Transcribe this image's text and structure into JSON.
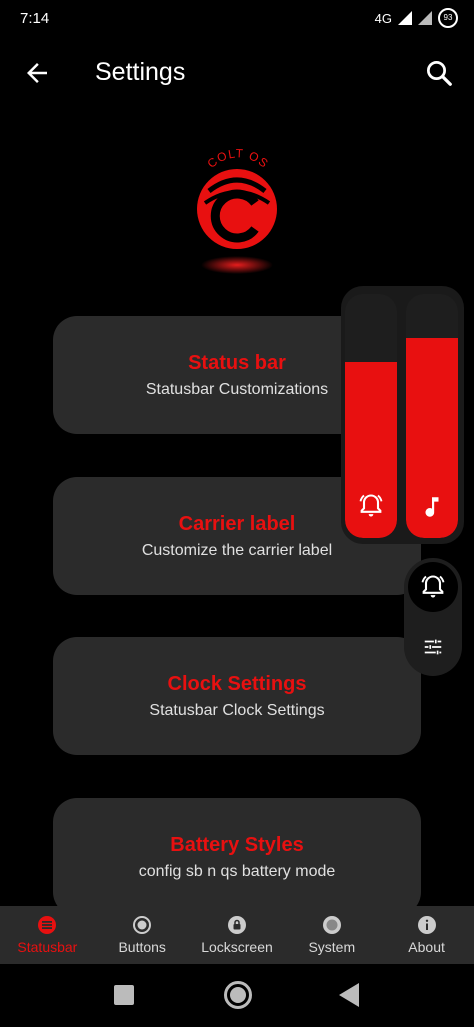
{
  "status_bar": {
    "time": "7:14",
    "network": "4G",
    "battery": "93"
  },
  "app_bar": {
    "title": "Settings"
  },
  "logo": {
    "text": "COLT OS"
  },
  "cards": [
    {
      "title": "Status bar",
      "subtitle": "Statusbar Customizations"
    },
    {
      "title": "Carrier label",
      "subtitle": "Customize the carrier label"
    },
    {
      "title": "Clock Settings",
      "subtitle": "Statusbar Clock Settings"
    },
    {
      "title": "Battery Styles",
      "subtitle": "config sb n qs battery mode"
    }
  ],
  "volume": {
    "ring_level": 0.72,
    "media_level": 0.82
  },
  "bottom_nav": [
    {
      "label": "Statusbar",
      "active": true
    },
    {
      "label": "Buttons"
    },
    {
      "label": "Lockscreen"
    },
    {
      "label": "System"
    },
    {
      "label": "About"
    }
  ],
  "colors": {
    "accent": "#e81010",
    "card_bg": "#2b2b2b",
    "background": "#000000"
  }
}
